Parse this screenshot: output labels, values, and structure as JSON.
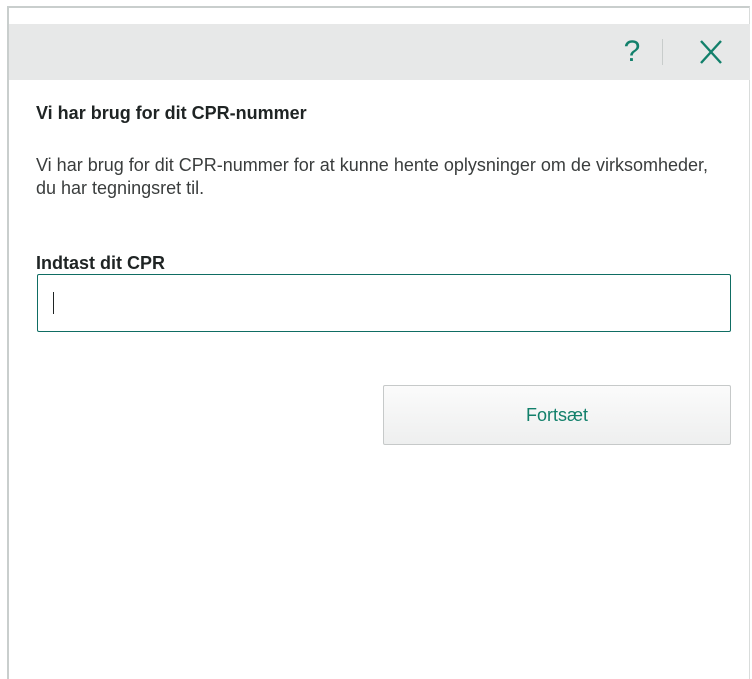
{
  "titlebar": {
    "help_label": "?",
    "help_icon": "question-mark-icon",
    "close_icon": "close-x-icon",
    "accent_color": "#12806b"
  },
  "dialog": {
    "heading": "Vi har brug for dit CPR-nummer",
    "description": "Vi har brug for dit CPR-nummer for at kunne hente oplysninger om de virksomheder, du har tegningsret til.",
    "cpr_label": "Indtast dit CPR",
    "cpr_value": "",
    "continue_label": "Fortsæt"
  }
}
